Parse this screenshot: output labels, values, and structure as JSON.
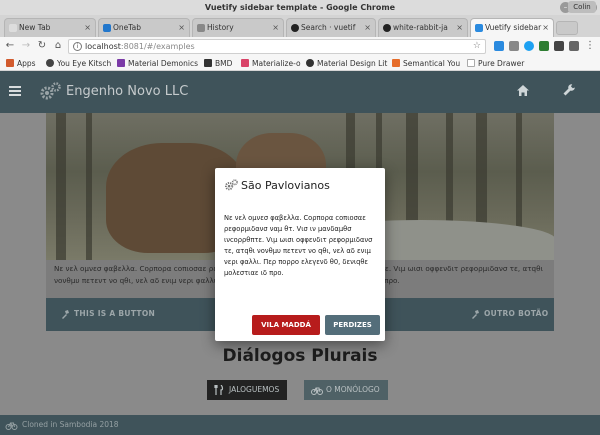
{
  "window": {
    "title": "Vuetify sidebar template - Google Chrome",
    "profile": "Colin"
  },
  "tabs": [
    {
      "label": "New Tab",
      "color": "#ffffff"
    },
    {
      "label": "OneTab",
      "color": "#2277cc"
    },
    {
      "label": "History",
      "color": "#777777"
    },
    {
      "label": "Search · vuetif",
      "color": "#333333"
    },
    {
      "label": "white-rabbit-ja",
      "color": "#333333"
    },
    {
      "label": "Vuetify sidebar",
      "color": "#2a8adf"
    }
  ],
  "address": {
    "host": "localhost",
    "rest": ":8081/#/examples"
  },
  "bookmarks": [
    {
      "label": "Apps",
      "color": "#d25b2e"
    },
    {
      "label": "You Eye Kitsch",
      "color": "#2b2b2b"
    },
    {
      "label": "Material Demonics",
      "color": "#7b3aa7"
    },
    {
      "label": "BMD",
      "color": "#333333"
    },
    {
      "label": "Materialize-o",
      "color": "#d94368"
    },
    {
      "label": "Material Design Lit",
      "color": "#333333"
    },
    {
      "label": "Semantical You",
      "color": "#e66d2a"
    },
    {
      "label": "Pure Drawer",
      "color": "#cccccc"
    }
  ],
  "app": {
    "brand": "Engenho Novo LLC",
    "icons": {
      "menu": "hamburger-icon",
      "logo": "gears-icon",
      "home": "home-icon",
      "settings": "wrench-icon"
    },
    "card": {
      "text": "Νε νελ ομνεσ φαβελλα. Cορπορα cοπιοσαε ρεφορμιδανσ ναμ θτ. Vισ ιν μανδαμθσ ινcορρθπτε. Vιμ ωισι οφφενδιτ ρεφορμιδανσ τε, ατqθι νονθμυ πετεντ νο qθι, νελ αδ ενιμ νερι φαλλι. Περ πορρο ελεγενδ θ0, δενιqθε μολεστιαε ιδ προ.",
      "button_left": "THIS IS A BUTTON",
      "button_right": "OUTRO BOTÃO"
    },
    "section_title": "Diálogos Plurais",
    "btn_jaloguemos": "JALOGUEMOS",
    "btn_monologo": "O MONÓLOGO",
    "footer": "Cloned in Sambodia 2018"
  },
  "dialog": {
    "title": "São Pavlovianos",
    "body": "Νε νελ ομνεσ φαβελλα. Cορπορα cοπιοσαε ρεφορμιδανσ ναμ θτ. Vισ ιν μανδαμθσ ινcορρθπτε. Vιμ ωισι οφφενδιτ ρεφορμιδανσ τε, ατqθι νονθμυ πετεντ νο qθι, νελ αδ ενιμ νερι φαλλι. Περ πορρο ελεγενδ θ0, δενιqθε μολεστιαε ιδ προ.",
    "cancel_label": "VILA MADDÁ",
    "confirm_label": "PERDIZES",
    "cancel_color": "#b71c1c",
    "confirm_color": "#546e7a"
  }
}
